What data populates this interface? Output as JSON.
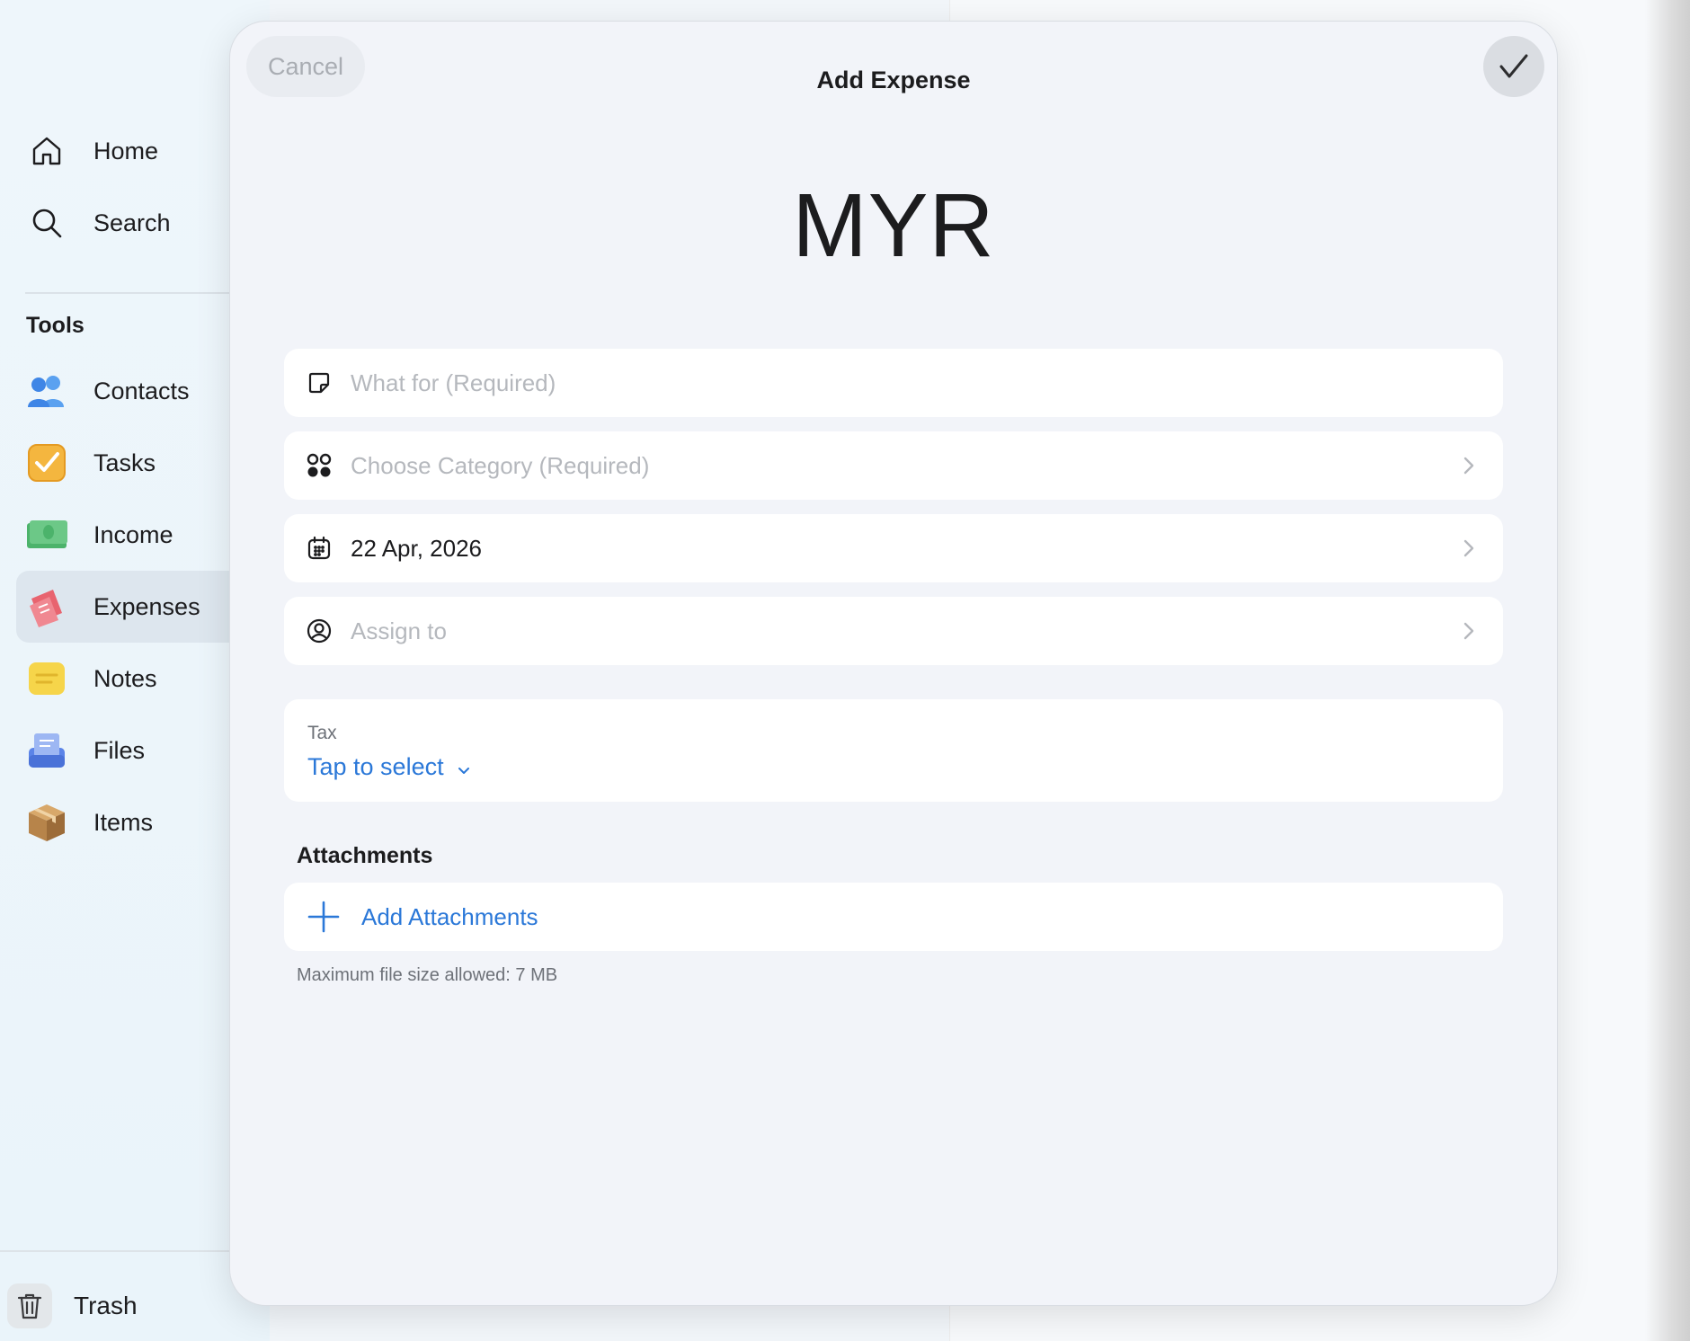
{
  "sidebar": {
    "nav": [
      {
        "label": "Home",
        "icon": "home-icon"
      },
      {
        "label": "Search",
        "icon": "search-icon"
      }
    ],
    "tools_title": "Tools",
    "tools": [
      {
        "label": "Contacts",
        "icon": "contacts-icon"
      },
      {
        "label": "Tasks",
        "icon": "tasks-icon"
      },
      {
        "label": "Income",
        "icon": "income-icon"
      },
      {
        "label": "Expenses",
        "icon": "expenses-icon",
        "active": true
      },
      {
        "label": "Notes",
        "icon": "notes-icon"
      },
      {
        "label": "Files",
        "icon": "files-icon"
      },
      {
        "label": "Items",
        "icon": "items-icon"
      }
    ],
    "trash_label": "Trash"
  },
  "modal": {
    "cancel_label": "Cancel",
    "title": "Add Expense",
    "currency": "MYR",
    "fields": {
      "what_for_placeholder": "What for (Required)",
      "category_placeholder": "Choose Category (Required)",
      "date_value": "22 Apr, 2026",
      "assign_placeholder": "Assign to"
    },
    "tax": {
      "label": "Tax",
      "select_label": "Tap to select"
    },
    "attachments": {
      "title": "Attachments",
      "add_label": "Add Attachments",
      "max_size_note": "Maximum file size allowed: 7 MB"
    }
  },
  "colors": {
    "accent": "#2b78d8",
    "placeholder": "#b5b8bd",
    "active_nav_bg": "#dde6ee"
  }
}
